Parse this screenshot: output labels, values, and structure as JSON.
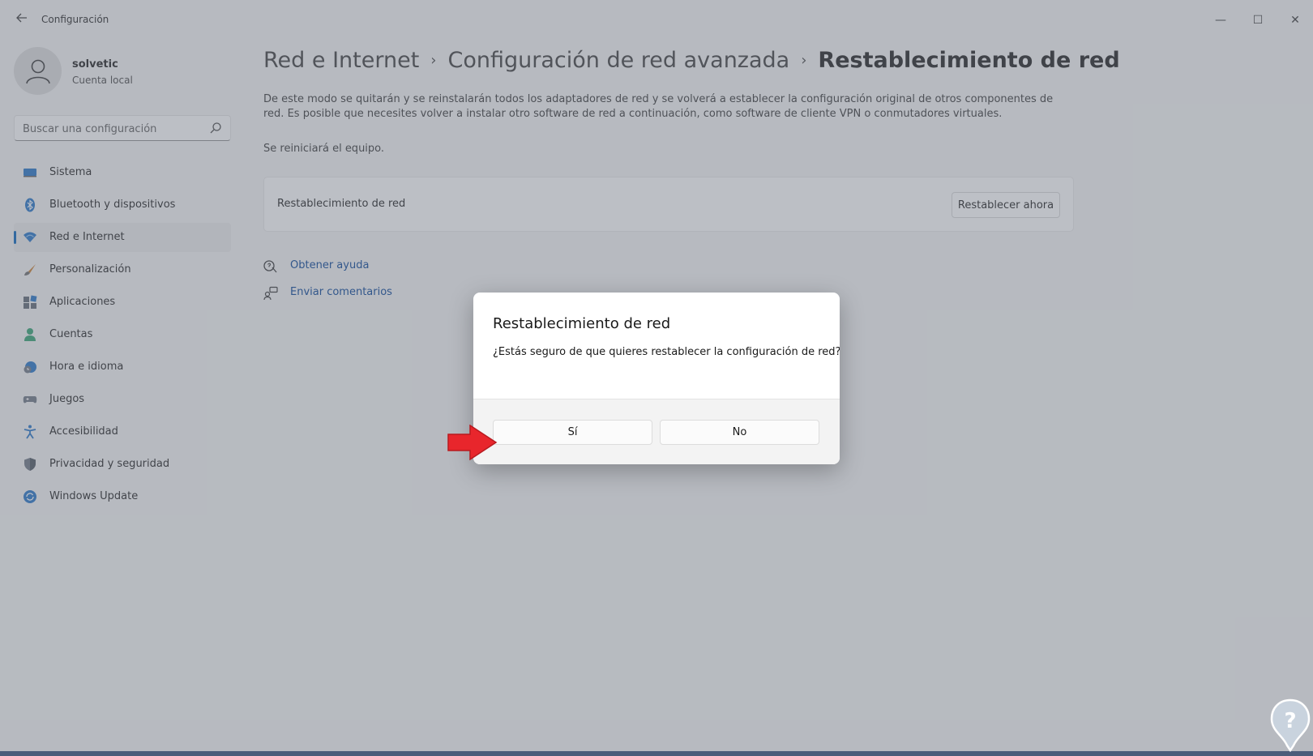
{
  "app": {
    "title": "Configuración"
  },
  "window_controls": {
    "minimize": "—",
    "maximize": "☐",
    "close": "✕"
  },
  "user": {
    "name": "solvetic",
    "account_type": "Cuenta local"
  },
  "search": {
    "placeholder": "Buscar una configuración"
  },
  "sidebar": {
    "items": [
      {
        "label": "Sistema",
        "icon": "system-icon"
      },
      {
        "label": "Bluetooth y dispositivos",
        "icon": "bluetooth-icon"
      },
      {
        "label": "Red e Internet",
        "icon": "wifi-icon",
        "selected": true
      },
      {
        "label": "Personalización",
        "icon": "brush-icon"
      },
      {
        "label": "Aplicaciones",
        "icon": "apps-icon"
      },
      {
        "label": "Cuentas",
        "icon": "person-icon"
      },
      {
        "label": "Hora e idioma",
        "icon": "clock-globe-icon"
      },
      {
        "label": "Juegos",
        "icon": "gamepad-icon"
      },
      {
        "label": "Accesibilidad",
        "icon": "accessibility-icon"
      },
      {
        "label": "Privacidad y seguridad",
        "icon": "shield-icon"
      },
      {
        "label": "Windows Update",
        "icon": "update-icon"
      }
    ]
  },
  "breadcrumb": {
    "items": [
      "Red e Internet",
      "Configuración de red avanzada",
      "Restablecimiento de red"
    ],
    "separator": "›"
  },
  "main": {
    "description": "De este modo se quitarán y se reinstalarán todos los adaptadores de red y se volverá a establecer la configuración original de otros componentes de red. Es posible que necesites volver a instalar otro software de red a continuación, como software de cliente VPN o conmutadores virtuales.",
    "restart_note": "Se reiniciará el equipo.",
    "card": {
      "label": "Restablecimiento de red",
      "button": "Restablecer ahora"
    },
    "links": {
      "help": "Obtener ayuda",
      "feedback": "Enviar comentarios"
    }
  },
  "dialog": {
    "title": "Restablecimiento de red",
    "message": "¿Estás seguro de que quieres restablecer la configuración de red?",
    "yes": "Sí",
    "no": "No"
  },
  "colors": {
    "accent": "#005fb8",
    "link": "#003e92",
    "arrow": "#e8262c",
    "logo": "#c9d3de"
  }
}
